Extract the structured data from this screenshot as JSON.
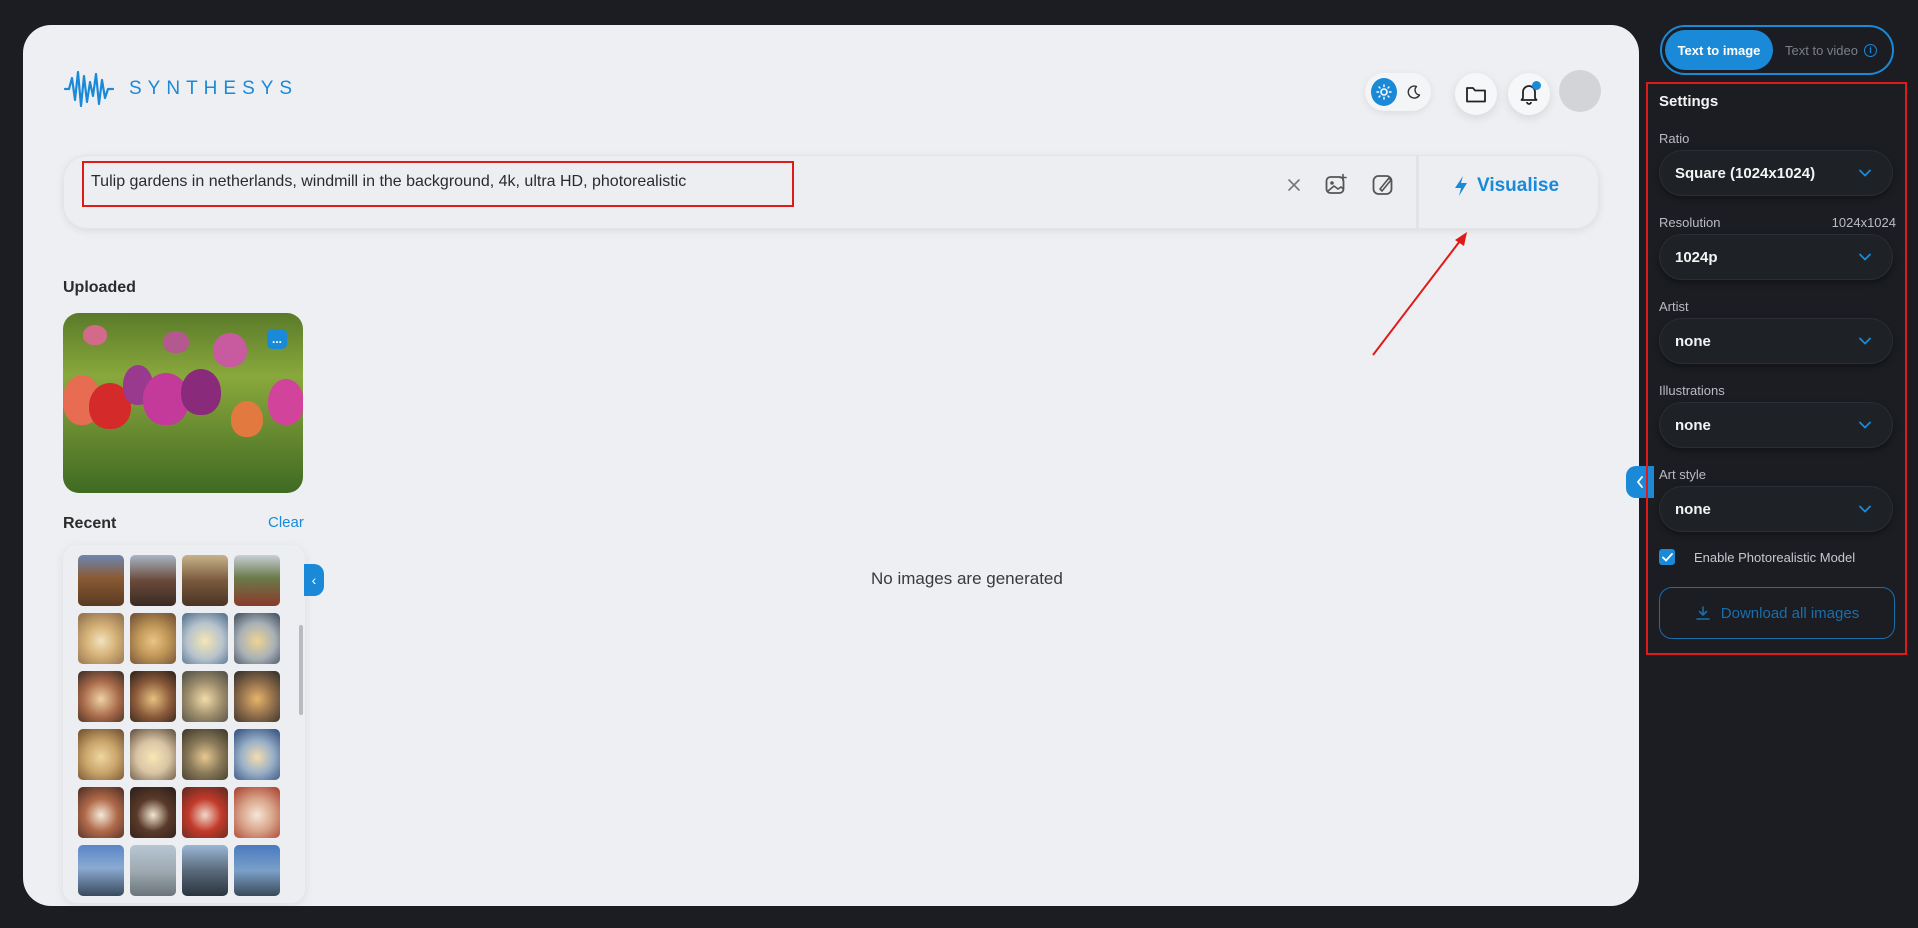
{
  "brand": {
    "name": "SYNTHESYS"
  },
  "header": {
    "theme_toggle": {
      "light_icon": "sun-icon",
      "dark_icon": "moon-icon",
      "active": "light"
    },
    "folder_icon": "folder-icon",
    "notification_icon": "bell-icon"
  },
  "prompt": {
    "value": "Tulip gardens in netherlands, windmill in the background, 4k, ultra HD, photorealistic",
    "clear_icon": "close-icon",
    "upload_icon": "image-add-icon",
    "edit_icon": "brush-icon",
    "visualise_label": "Visualise"
  },
  "uploaded": {
    "title": "Uploaded",
    "menu_label": "..."
  },
  "recent": {
    "title": "Recent",
    "clear_label": "Clear",
    "thumb_count": 24
  },
  "main": {
    "empty_message": "No images are generated"
  },
  "mode_toggle": {
    "active_label": "Text to image",
    "inactive_label": "Text to video"
  },
  "settings": {
    "title": "Settings",
    "ratio": {
      "label": "Ratio",
      "value": "Square (1024x1024)"
    },
    "resolution": {
      "label": "Resolution",
      "extra": "1024x1024",
      "value": "1024p"
    },
    "artist": {
      "label": "Artist",
      "value": "none"
    },
    "illustrations": {
      "label": "Illustrations",
      "value": "none"
    },
    "art_style": {
      "label": "Art style",
      "value": "none"
    },
    "photorealistic": {
      "label": "Enable Photorealistic Model",
      "checked": true
    },
    "download_label": "Download all images"
  },
  "colors": {
    "accent": "#1a8ad8",
    "highlight": "#e01919",
    "sidebar_bg": "#1b1d22",
    "card_bg": "#eeeff2"
  }
}
